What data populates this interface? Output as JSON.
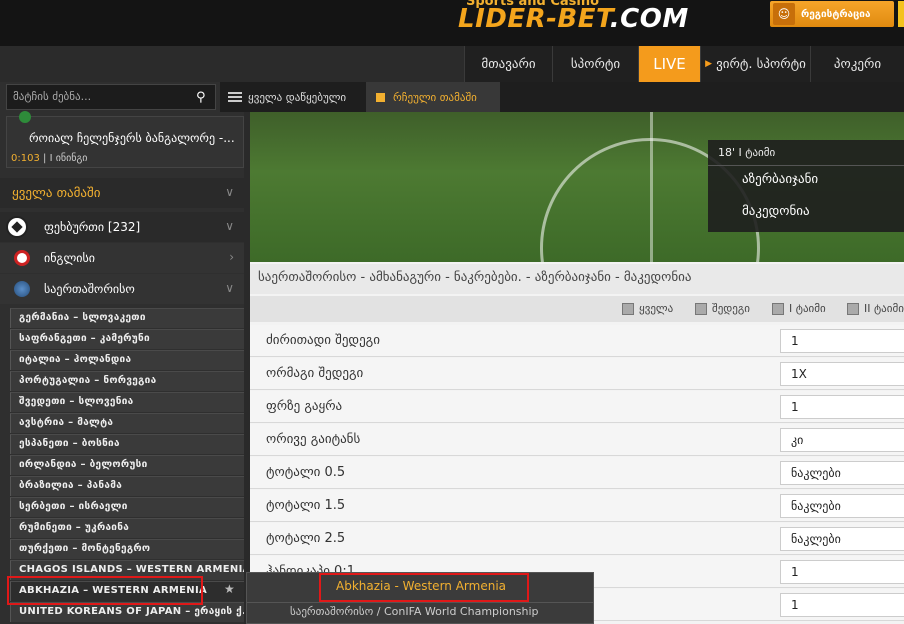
{
  "header": {
    "logo_sub": "Sports and Casino",
    "logo_main": "LIDER-BET",
    "logo_tld": ".COM",
    "register_label": "რეგისტრაცია"
  },
  "nav": [
    "მთავარი",
    "სპორტი",
    "LIVE",
    "ვირტ. სპორტი",
    "პოკერი"
  ],
  "search": {
    "placeholder": "მატჩის ძებნა..."
  },
  "filters": {
    "all_collapsed": "ყველა დაწყებული",
    "favorite": "რჩეული თამაში"
  },
  "live_card": {
    "team": "როიალ ჩელენჯერს ბანგალორე -...",
    "time": "0:103",
    "period": "I ინინგი"
  },
  "sidebar": {
    "all_games": "ყველა თამაში",
    "sport": "ფეხბურთი [232]",
    "countries": [
      "ინგლისი",
      "საერთაშორისო"
    ],
    "matches": [
      "გერმანია – სლოვაკეთი",
      "საფრანგეთი – კამერუნი",
      "იტალია – ჰოლანდია",
      "პორტუგალია – ნორვეგია",
      "შვედეთი – სლოვენია",
      "ავსტრია – მალტა",
      "ესპანეთი – ბოსნია",
      "ირლანდია – ბელორუსი",
      "ბრაზილია – პანამა",
      "სერბეთი – ისრაელი",
      "რუმინეთი – უკრაინა",
      "თურქეთი – მონტენეგრო",
      "CHAGOS ISLANDS – WESTERN ARMENIA",
      "ABKHAZIA – WESTERN ARMENIA",
      "UNITED KOREANS OF JAPAN – ერაყის ქ..."
    ]
  },
  "scoreboard": {
    "time": "18' I ტაიმი",
    "team1": "აზერბაიჯანი",
    "team2": "მაკედონია"
  },
  "breadcrumb": "საერთაშორისო - ამხანაგური - ნაკრებები. - აზერბაიჯანი - მაკედონია",
  "filter_checks": [
    "ყველა",
    "შედეგი",
    "I ტაიმი",
    "II ტაიმი"
  ],
  "bets": [
    {
      "label": "ძირითადი შედეგი",
      "value": "1"
    },
    {
      "label": "ორმაგი შედეგი",
      "value": "1X"
    },
    {
      "label": "ფრზე გაყრა",
      "value": "1"
    },
    {
      "label": "ორივე გაიტანს",
      "value": "კი"
    },
    {
      "label": "ტოტალი 0.5",
      "value": "ნაკლები"
    },
    {
      "label": "ტოტალი 1.5",
      "value": "ნაკლები"
    },
    {
      "label": "ტოტალი 2.5",
      "value": "ნაკლები"
    },
    {
      "label": "ჰანდიკაპი 0:1",
      "value": "1"
    },
    {
      "label": "",
      "value": "1"
    }
  ],
  "popup": {
    "title": "Abkhazia - Western Armenia",
    "subtitle": "საერთაშორისო / ConIFA World Championship"
  }
}
